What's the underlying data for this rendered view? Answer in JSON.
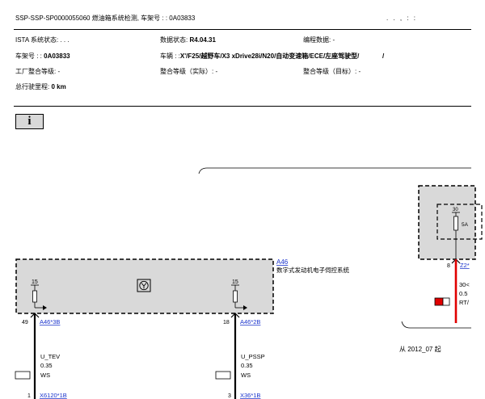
{
  "header": {
    "title": "SSP-SSP-SP0000055060 燃油箱系统检测, 车架号 : : 0A03833",
    "right_dots": ". .   ,   :   :"
  },
  "info": {
    "ista_status": "ISTA 系统状态: .   .   .",
    "data_status_label": "数据状态:",
    "data_status_value": "R4.04.31",
    "prog_data": "编程数据: -",
    "vin_label": "车架号 : :",
    "vin_value": "0A03833",
    "vehicle_label": "车辆 : :",
    "vehicle_value": "X'/F25/越野车/X3 xDrive28i/N20/自动变速箱/ECE/左座驾驶型/",
    "vehicle_tail": "/",
    "factory_level": "工厂整合等级: -",
    "int_level_actual": "整合等级（实际）: -",
    "int_level_target": "整合等级（目标）: -",
    "mileage_label": "总行驶里程:",
    "mileage_value": "0 km"
  },
  "info_button": "i",
  "diagram": {
    "a46_id": "A46",
    "a46_desc": "数字式发动机电子伺控系统",
    "fuse_left_num": "15",
    "fuse_right_num": "15",
    "fuse_top_num": "30",
    "fuse_top_rating": "5A",
    "pin_left": "49",
    "conn_left": "A46*3B",
    "pin_right": "18",
    "conn_right": "A46*2B",
    "pin_top": "8",
    "conn_top": "Z2*",
    "wire_left_name": "U_TEV",
    "wire_left_gauge": "0.35",
    "wire_left_color": "WS",
    "wire_right_name": "U_PSSP",
    "wire_right_gauge": "0.35",
    "wire_right_color": "WS",
    "wire_red_gauge_a": "30<",
    "wire_red_gauge_b": "0.5",
    "wire_red_color": "RT/",
    "from_date": "从 2012_07 起",
    "bottom_pin_left": "1",
    "bottom_conn_left": "X6120*1B",
    "bottom_pin_right": "3",
    "bottom_conn_right": "X36*1B"
  },
  "colors": {
    "box_fill": "#d9d9d9",
    "wire_red": "#e00000",
    "link": "#1a33cc"
  }
}
